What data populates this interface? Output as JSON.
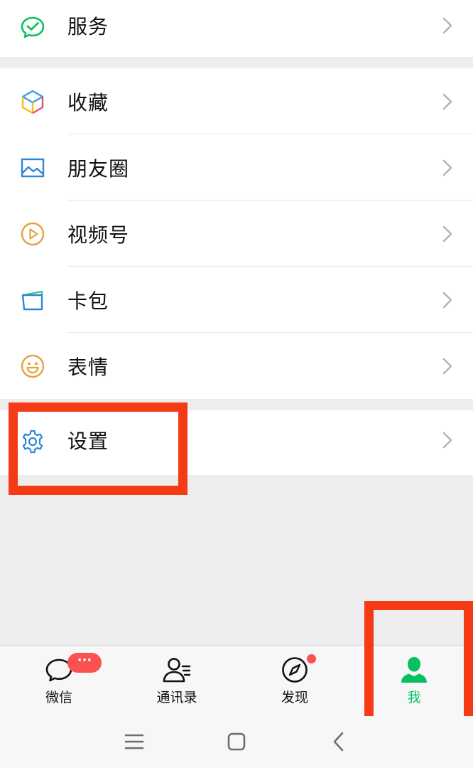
{
  "groups": {
    "services": {
      "items": [
        {
          "label": "服务",
          "icon": "wechat-pay-check-icon"
        }
      ]
    },
    "main": {
      "items": [
        {
          "label": "收藏",
          "icon": "cube-icon"
        },
        {
          "label": "朋友圈",
          "icon": "picture-icon"
        },
        {
          "label": "视频号",
          "icon": "play-circle-icon"
        },
        {
          "label": "卡包",
          "icon": "card-wallet-icon"
        },
        {
          "label": "表情",
          "icon": "smile-icon"
        }
      ]
    },
    "settings": {
      "items": [
        {
          "label": "设置",
          "icon": "gear-icon"
        }
      ]
    }
  },
  "tabbar": {
    "tabs": [
      {
        "label": "微信",
        "icon": "chat-bubble-icon",
        "badge": "···"
      },
      {
        "label": "通讯录",
        "icon": "contacts-icon"
      },
      {
        "label": "发现",
        "icon": "compass-icon"
      },
      {
        "label": "我",
        "icon": "person-icon",
        "active": true
      }
    ]
  },
  "colors": {
    "accent": "#07c160",
    "badge": "#fa5151",
    "annotation": "#f43b16",
    "background": "#ededed"
  }
}
